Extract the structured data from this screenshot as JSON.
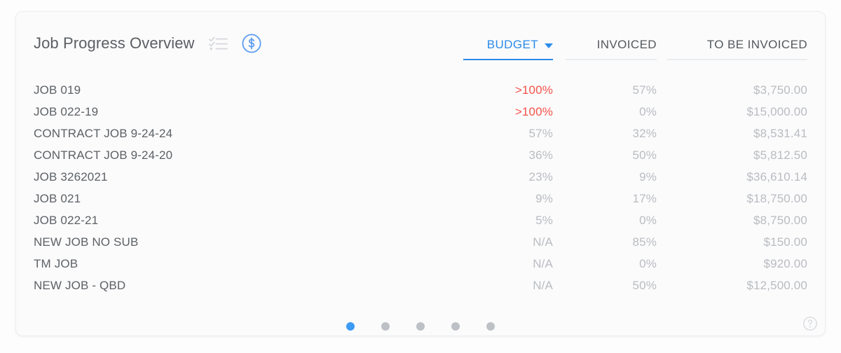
{
  "card": {
    "title": "Job Progress Overview",
    "icons": [
      {
        "name": "checklist-icon"
      },
      {
        "name": "dollar-circle-icon"
      }
    ]
  },
  "columns": [
    {
      "key": "budget",
      "label": "BUDGET",
      "active": true,
      "has_caret": true
    },
    {
      "key": "invoiced",
      "label": "INVOICED",
      "active": false,
      "has_caret": false
    },
    {
      "key": "tobe",
      "label": "TO BE INVOICED",
      "active": false,
      "has_caret": false
    }
  ],
  "rows": [
    {
      "name": "JOB 019",
      "budget": ">100%",
      "budget_over": true,
      "invoiced": "57%",
      "to_be_invoiced": "$3,750.00"
    },
    {
      "name": "JOB 022-19",
      "budget": ">100%",
      "budget_over": true,
      "invoiced": "0%",
      "to_be_invoiced": "$15,000.00"
    },
    {
      "name": "CONTRACT JOB 9-24-24",
      "budget": "57%",
      "budget_over": false,
      "invoiced": "32%",
      "to_be_invoiced": "$8,531.41"
    },
    {
      "name": "CONTRACT JOB 9-24-20",
      "budget": "36%",
      "budget_over": false,
      "invoiced": "50%",
      "to_be_invoiced": "$5,812.50"
    },
    {
      "name": "JOB 3262021",
      "budget": "23%",
      "budget_over": false,
      "invoiced": "9%",
      "to_be_invoiced": "$36,610.14"
    },
    {
      "name": "JOB 021",
      "budget": "9%",
      "budget_over": false,
      "invoiced": "17%",
      "to_be_invoiced": "$18,750.00"
    },
    {
      "name": "JOB 022-21",
      "budget": "5%",
      "budget_over": false,
      "invoiced": "0%",
      "to_be_invoiced": "$8,750.00"
    },
    {
      "name": "NEW JOB NO SUB",
      "budget": "N/A",
      "budget_over": false,
      "invoiced": "85%",
      "to_be_invoiced": "$150.00"
    },
    {
      "name": "TM JOB",
      "budget": "N/A",
      "budget_over": false,
      "invoiced": "0%",
      "to_be_invoiced": "$920.00"
    },
    {
      "name": "NEW JOB - QBD",
      "budget": "N/A",
      "budget_over": false,
      "invoiced": "50%",
      "to_be_invoiced": "$12,500.00"
    }
  ],
  "pagination": {
    "total": 5,
    "active_index": 0
  },
  "help": {
    "name": "help-circle-icon"
  },
  "colors": {
    "accent_blue": "#2b8bea",
    "dot_active": "#3d9bf5",
    "dot_inactive": "#bdc1c6",
    "over_budget_red": "#f4544a",
    "row_name": "#5d6165",
    "row_value": "#b9bcc0",
    "title": "#5b5e62"
  }
}
